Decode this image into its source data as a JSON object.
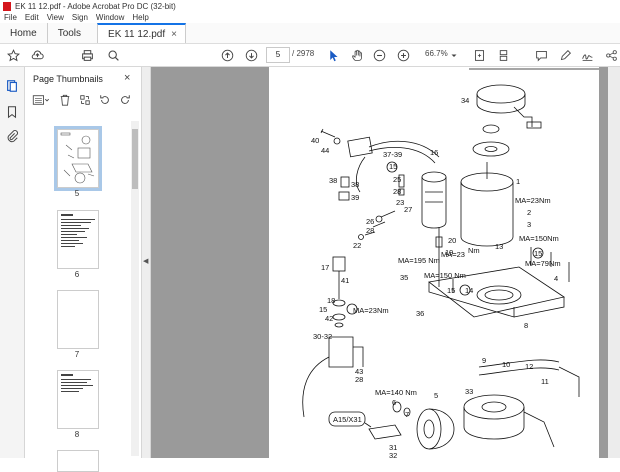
{
  "window": {
    "title": "EK 11 12.pdf - Adobe Acrobat Pro DC (32-bit)"
  },
  "menu": [
    "File",
    "Edit",
    "View",
    "Sign",
    "Window",
    "Help"
  ],
  "tabs": {
    "home": "Home",
    "tools": "Tools",
    "document": "EK 11 12.pdf",
    "close": "×"
  },
  "toolbar": {
    "page_current": "5",
    "page_total": "/ 2978",
    "zoom": "66.7%"
  },
  "panel": {
    "title": "Page Thumbnails",
    "close": "×",
    "thumbnails": [
      {
        "label": "5",
        "selected": true
      },
      {
        "label": "6",
        "selected": false
      },
      {
        "label": "7",
        "selected": false
      },
      {
        "label": "8",
        "selected": false
      }
    ]
  },
  "diagram": {
    "labels": {
      "l34": "34",
      "l40": "40",
      "l44": "44",
      "l37": "37-39",
      "l16": "16",
      "l15a": "15",
      "l25": "25",
      "l28a": "28",
      "l38a": "38",
      "l38b": "38",
      "l39": "39",
      "l1": "1",
      "l27": "27",
      "l23": "23",
      "l26": "26",
      "l28b": "28",
      "l22": "22",
      "l20": "20",
      "l19": "19",
      "ma23a": "MA=23Nm",
      "l2": "2",
      "l3": "3",
      "ma150a": "MA=150Nm",
      "l13": "13",
      "l15b": "15",
      "ma79": "MA=79Nm",
      "nm": "Nm",
      "ma23b": "MA=23",
      "ma195": "MA=195 Nm",
      "l35": "35",
      "ma150b": "MA=150 Nm",
      "l14": "14",
      "l15c": "15",
      "l4": "4",
      "l17": "17",
      "l41": "41",
      "l18": "18",
      "l15d": "15",
      "ma23c": "MA=23Nm",
      "l42": "42",
      "l36": "36",
      "l8": "8",
      "l3032": "30-32",
      "l9": "9",
      "l10": "10",
      "l12": "12",
      "l43": "43",
      "l28c": "28",
      "l11": "11",
      "ma140": "MA=140 Nm",
      "l33": "33",
      "l6": "6",
      "l7": "7",
      "l5": "5",
      "a15": "A15/X31",
      "l31": "31",
      "l32": "32"
    }
  }
}
